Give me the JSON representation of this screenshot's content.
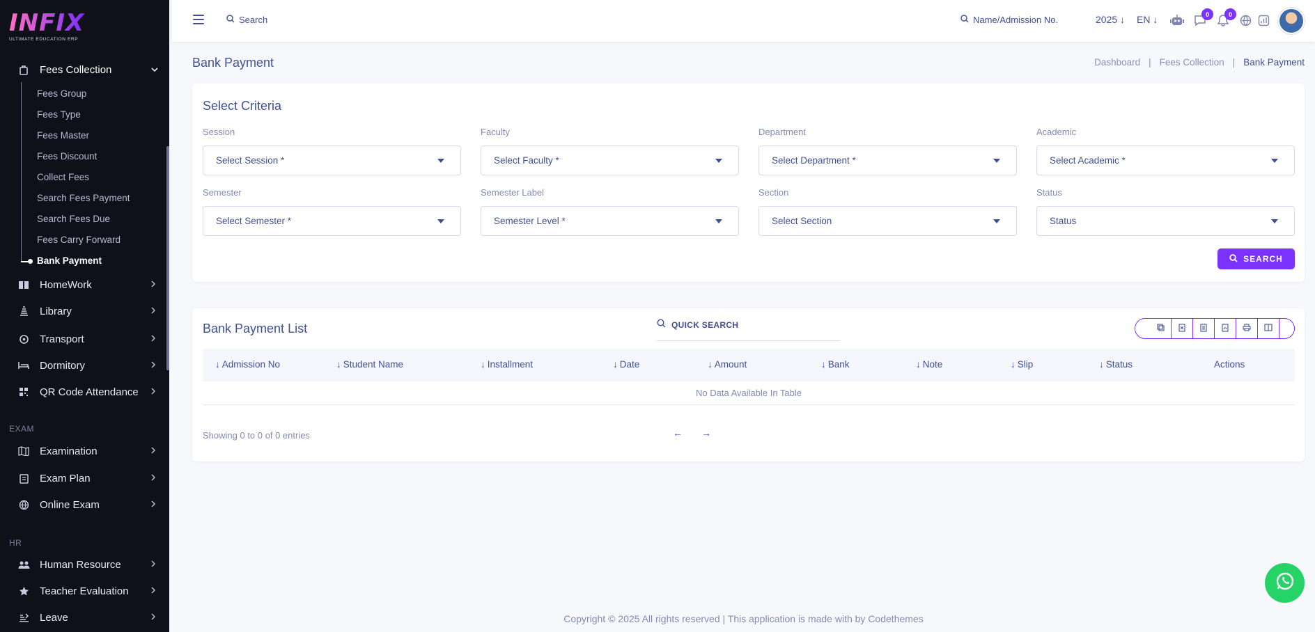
{
  "logo": {
    "word": "INFIX",
    "tagline": "ULTIMATE EDUCATION ERP"
  },
  "sidebar": {
    "active_group": {
      "label": "Fees Collection",
      "icon": "fees-collection-icon"
    },
    "sub_items": [
      "Fees Group",
      "Fees Type",
      "Fees Master",
      "Fees Discount",
      "Collect Fees",
      "Search Fees Payment",
      "Search Fees Due",
      "Fees Carry Forward",
      "Bank Payment"
    ],
    "groups_top": [
      {
        "label": "HomeWork",
        "icon": "book-icon"
      },
      {
        "label": "Library",
        "icon": "library-icon"
      },
      {
        "label": "Transport",
        "icon": "transport-icon"
      },
      {
        "label": "Dormitory",
        "icon": "bed-icon"
      },
      {
        "label": "QR Code Attendance",
        "icon": "qr-code-icon"
      }
    ],
    "section_exam": "EXAM",
    "groups_exam": [
      {
        "label": "Examination",
        "icon": "map-icon"
      },
      {
        "label": "Exam Plan",
        "icon": "clipboard-icon"
      },
      {
        "label": "Online Exam",
        "icon": "globe-icon"
      }
    ],
    "section_hr": "HR",
    "groups_hr": [
      {
        "label": "Human Resource",
        "icon": "users-icon"
      },
      {
        "label": "Teacher Evaluation",
        "icon": "star-icon"
      },
      {
        "label": "Leave",
        "icon": "leave-icon"
      }
    ]
  },
  "header": {
    "search_placeholder": "Search",
    "student_search": "Name/Admission No.",
    "year": "2025",
    "language": "EN",
    "chat_count": "0",
    "notification_count": "0"
  },
  "page": {
    "title": "Bank Payment",
    "breadcrumb": [
      "Dashboard",
      "Fees Collection",
      "Bank Payment"
    ]
  },
  "criteria": {
    "title": "Select Criteria",
    "fields": [
      {
        "label": "Session",
        "value": "Select Session *"
      },
      {
        "label": "Faculty",
        "value": "Select Faculty *"
      },
      {
        "label": "Department",
        "value": "Select Department *"
      },
      {
        "label": "Academic",
        "value": "Select Academic *"
      },
      {
        "label": "Semester",
        "value": "Select Semester *"
      },
      {
        "label": "Semester Label",
        "value": "Semester Level *"
      },
      {
        "label": "Section",
        "value": "Select Section"
      },
      {
        "label": "Status",
        "value": "Status"
      }
    ],
    "search_button": "SEARCH"
  },
  "list": {
    "title": "Bank Payment List",
    "quick_search": "QUICK SEARCH",
    "columns": [
      "Admission No",
      "Student Name",
      "Installment",
      "Date",
      "Amount",
      "Bank",
      "Note",
      "Slip",
      "Status",
      "Actions"
    ],
    "empty_text": "No Data Available In Table",
    "showing": "Showing 0 to 0 of 0 entries",
    "pager_prev": "←",
    "pager_next": "→"
  },
  "footer": {
    "text": "Copyright © 2025 All rights reserved | This application is made with by Codethemes"
  },
  "colors": {
    "accent": "#7c32ff",
    "text": "#415094",
    "sidebar": "#0f101a",
    "whatsapp": "#25d366"
  }
}
